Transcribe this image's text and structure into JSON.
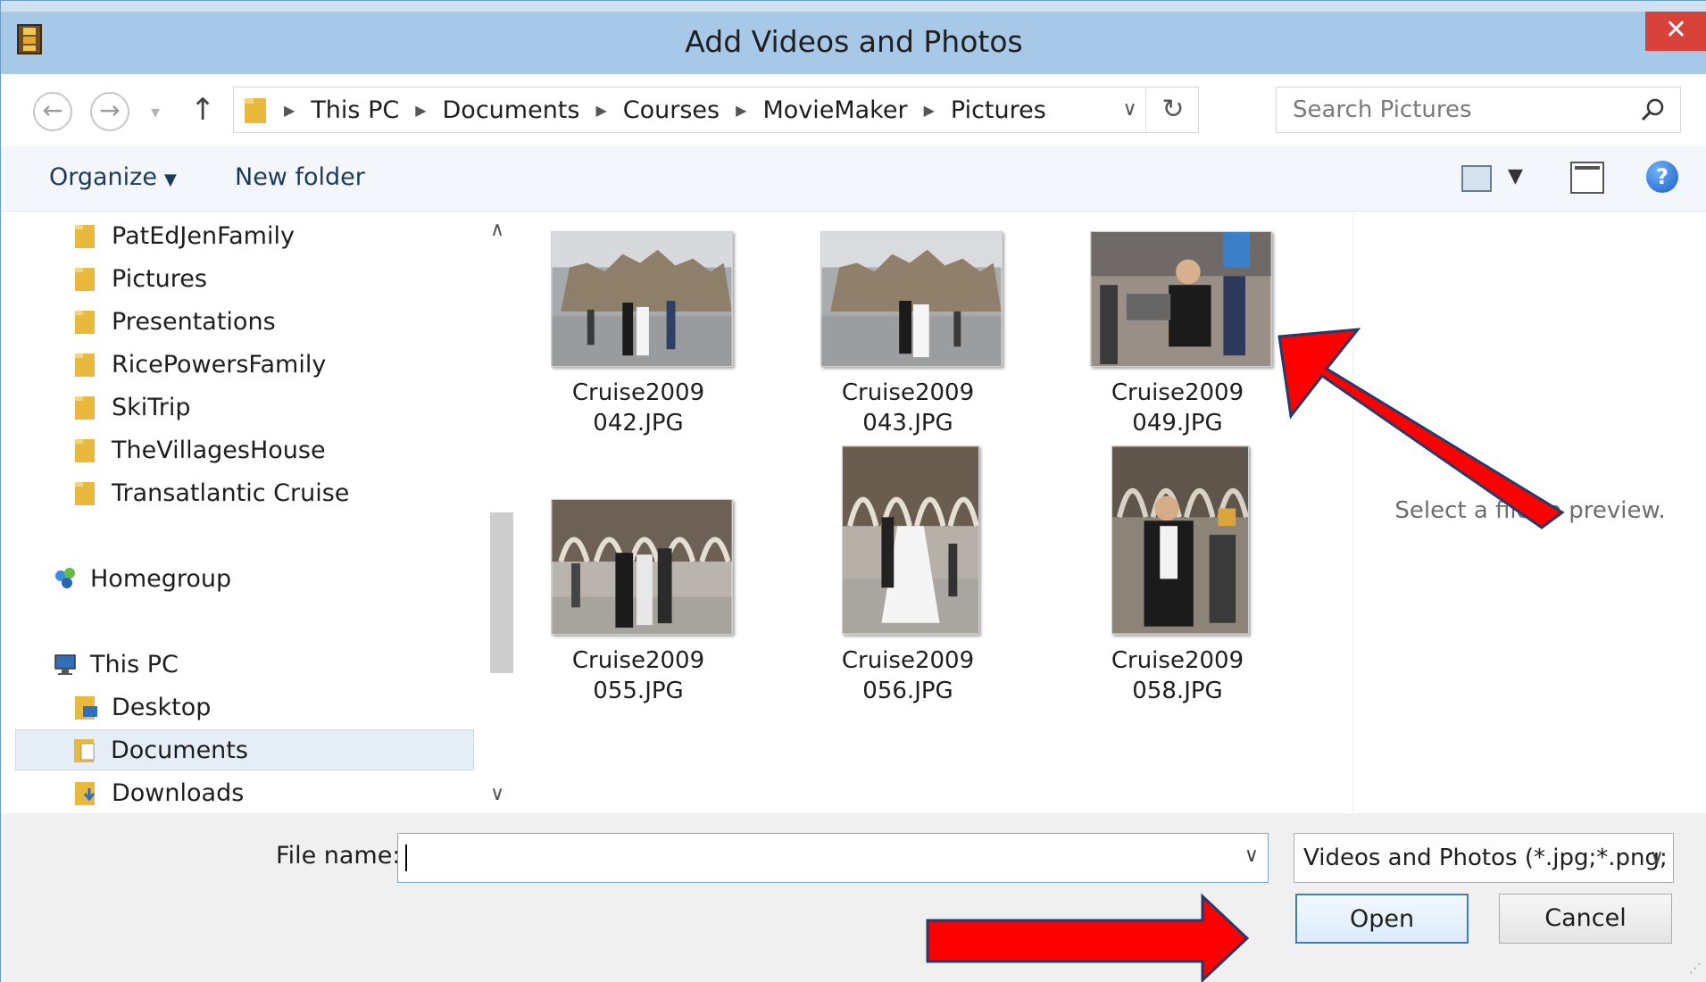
{
  "window": {
    "title": "Add Videos and Photos",
    "close_label": "✕"
  },
  "address": {
    "crumbs": [
      "This PC",
      "Documents",
      "Courses",
      "MovieMaker",
      "Pictures"
    ],
    "search_placeholder": "Search Pictures"
  },
  "toolbar": {
    "organize": "Organize",
    "new_folder": "New folder"
  },
  "nav": {
    "items": [
      {
        "label": "PatEdJenFamily",
        "icon": "folder-icon"
      },
      {
        "label": "Pictures",
        "icon": "folder-icon"
      },
      {
        "label": "Presentations",
        "icon": "folder-icon"
      },
      {
        "label": "RicePowersFamily",
        "icon": "folder-icon"
      },
      {
        "label": "SkiTrip",
        "icon": "folder-icon"
      },
      {
        "label": "TheVillagesHouse",
        "icon": "folder-icon"
      },
      {
        "label": "Transatlantic Cruise",
        "icon": "folder-icon"
      },
      {
        "label": "Homegroup",
        "icon": "homegroup-icon"
      },
      {
        "label": "This PC",
        "icon": "computer-icon"
      },
      {
        "label": "Desktop",
        "icon": "desktop-folder-icon"
      },
      {
        "label": "Documents",
        "icon": "documents-folder-icon",
        "selected": true
      },
      {
        "label": "Downloads",
        "icon": "downloads-folder-icon"
      }
    ]
  },
  "files": [
    {
      "name_line1": "Cruise2009",
      "name_line2": "042.JPG"
    },
    {
      "name_line1": "Cruise2009",
      "name_line2": "043.JPG"
    },
    {
      "name_line1": "Cruise2009",
      "name_line2": "049.JPG"
    },
    {
      "name_line1": "Cruise2009",
      "name_line2": "055.JPG"
    },
    {
      "name_line1": "Cruise2009",
      "name_line2": "056.JPG"
    },
    {
      "name_line1": "Cruise2009",
      "name_line2": "058.JPG"
    }
  ],
  "preview": {
    "text": "Select a file to preview."
  },
  "footer": {
    "file_name_label": "File name:",
    "file_name_value": "",
    "file_type": "Videos and Photos (*.jpg;*.png;",
    "open_label": "Open",
    "cancel_label": "Cancel"
  },
  "colors": {
    "titlebar": "#a7c8e6",
    "close": "#d9413b",
    "annotation_arrow": "#ff0000"
  }
}
